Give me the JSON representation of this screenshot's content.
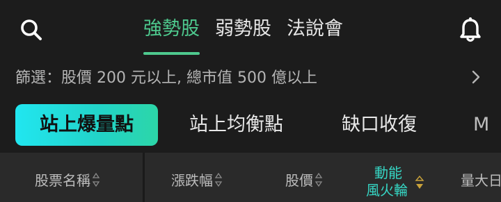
{
  "header": {
    "search_icon": "search-icon",
    "bell_icon": "bell-icon",
    "tabs": [
      {
        "label": "強勢股",
        "active": true
      },
      {
        "label": "弱勢股",
        "active": false
      },
      {
        "label": "法說會",
        "active": false
      }
    ]
  },
  "filter": {
    "text": "篩選：股價 200 元以上, 總市值 500 億以上",
    "chevron_icon": "chevron-right-icon"
  },
  "chips": [
    {
      "label": "站上爆量點",
      "active": true
    },
    {
      "label": "站上均衡點",
      "active": false
    },
    {
      "label": "缺口收復",
      "active": false
    },
    {
      "label": "M",
      "active": false
    }
  ],
  "table_header": {
    "columns": [
      {
        "label": "股票名稱"
      },
      {
        "label": "漲跌幅"
      },
      {
        "label": "股價"
      },
      {
        "label_line1": "動能",
        "label_line2": "風火輪",
        "sorted": "desc"
      },
      {
        "label": "量大日"
      }
    ]
  },
  "colors": {
    "background": "#1c1c1c",
    "accent_green": "#4ec98e",
    "chip_gradient_start": "#21e6f0",
    "chip_gradient_end": "#2cd6a8",
    "momentum_text": "#36d6c4",
    "sort_active": "#c9a23a",
    "header_bg": "#2a2a2a"
  }
}
